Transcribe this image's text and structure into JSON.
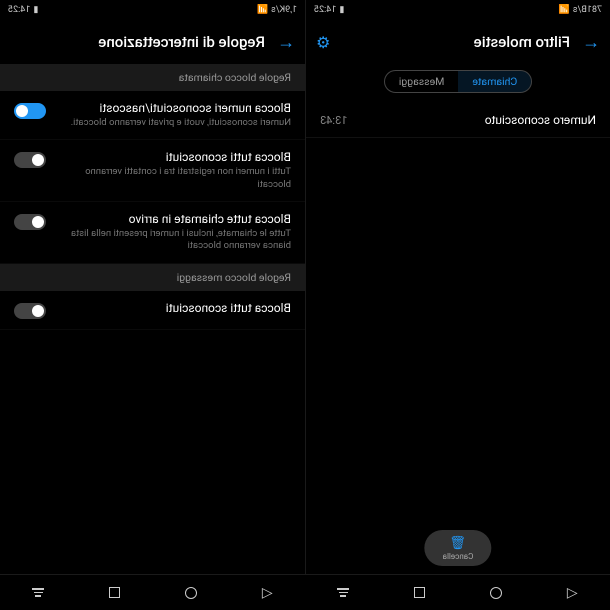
{
  "left": {
    "status": {
      "speed": "781B/s",
      "time": "14:25",
      "battery": "84"
    },
    "header": {
      "title": "Filtro molestie"
    },
    "tabs": {
      "calls": "Chiamate",
      "messages": "Messaggi"
    },
    "entry": {
      "name": "Numero sconosciuto",
      "time": "13:43"
    },
    "delete": {
      "label": "Cancella"
    }
  },
  "right": {
    "status": {
      "speed": "1,9K/s",
      "time": "14:25",
      "battery": "84"
    },
    "header": {
      "title": "Regole di intercettazione"
    },
    "sections": {
      "calls": {
        "header": "Regole blocco chiamata",
        "items": [
          {
            "title": "Blocca numeri sconosciuti/nascosti",
            "desc": "Numeri sconosciuti, vuoti e privati verranno bloccati.",
            "on": true
          },
          {
            "title": "Blocca tutti sconosciuti",
            "desc": "Tutti i numeri non registrati tra i contatti verranno bloccati",
            "on": false
          },
          {
            "title": "Blocca tutte chiamate in arrivo",
            "desc": "Tutte le chiamate, inclusi i numeri presenti nella lista bianca verranno bloccati",
            "on": false
          }
        ]
      },
      "messages": {
        "header": "Regole blocco messaggi",
        "items": [
          {
            "title": "Blocca tutti sconosciuti",
            "desc": "",
            "on": false
          }
        ]
      }
    }
  }
}
